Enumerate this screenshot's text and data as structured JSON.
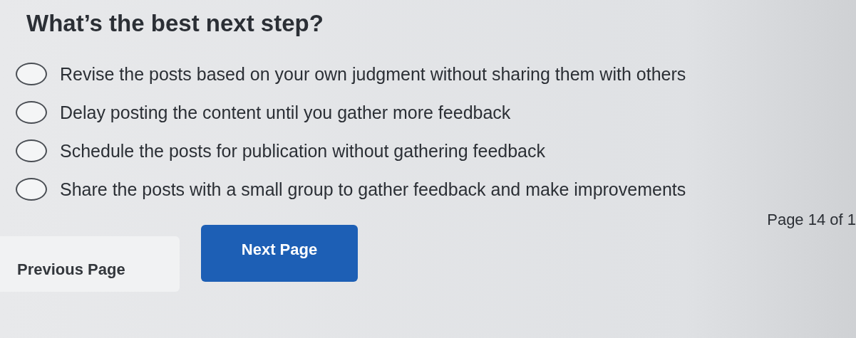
{
  "question": {
    "title": "What’s the best next step?"
  },
  "options": [
    {
      "label": "Revise the posts based on your own judgment without sharing them with others",
      "selected": false
    },
    {
      "label": "Delay posting the content until you gather more feedback",
      "selected": false
    },
    {
      "label": "Schedule the posts for publication without gathering feedback",
      "selected": false
    },
    {
      "label": "Share the posts with a small group to gather feedback and make improvements",
      "selected": false
    }
  ],
  "pagination": {
    "indicator": "Page 14 of 1",
    "previous": "Previous Page",
    "next": "Next Page"
  }
}
